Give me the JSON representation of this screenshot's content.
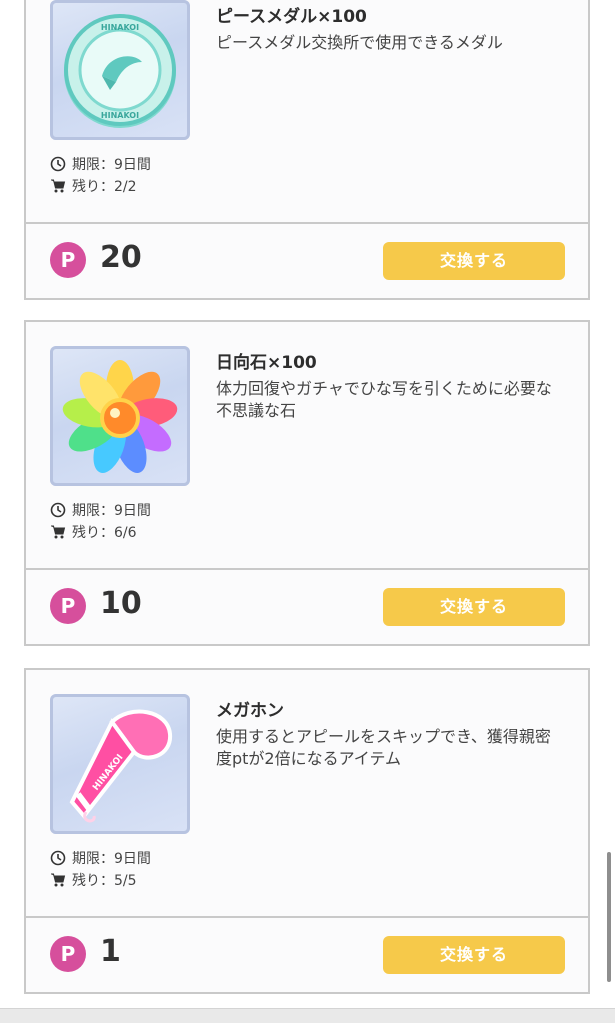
{
  "items": [
    {
      "name": "ピースメダル×100",
      "description": "ピースメダル交換所で使用できるメダル",
      "deadline": "期限：9日間",
      "remaining": "残り：2/2",
      "price": "20",
      "button_label": "交換する",
      "icon": "peace-medal-icon"
    },
    {
      "name": "日向石×100",
      "description": "体力回復やガチャでひな写を引くために必要な不思議な石",
      "deadline": "期限：9日間",
      "remaining": "残り：6/6",
      "price": "10",
      "button_label": "交換する",
      "icon": "hinata-stone-icon"
    },
    {
      "name": "メガホン",
      "description": "使用するとアピールをスキップでき、獲得親密度ptが2倍になるアイテム",
      "deadline": "期限：9日間",
      "remaining": "残り：5/5",
      "price": "1",
      "button_label": "交換する",
      "icon": "megaphone-icon"
    }
  ],
  "currency_symbol": "P",
  "colors": {
    "currency": "#d64f9c",
    "button": "#f6c94a",
    "border": "#c9c9c9"
  }
}
